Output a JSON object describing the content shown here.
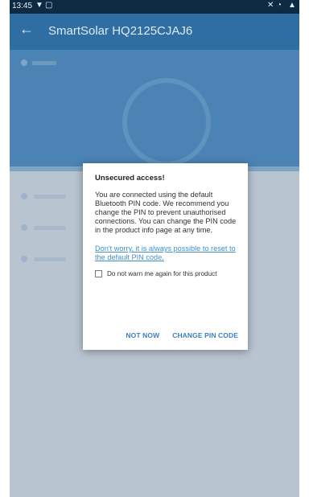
{
  "status_bar": {
    "time": "13:45",
    "icons": [
      "wifi-alert-icon",
      "image-icon",
      "mute-icon",
      "wifi-icon",
      "signal-icon"
    ]
  },
  "app_bar": {
    "back_icon": "arrow-left-icon",
    "title": "SmartSolar HQ2125CJAJ6"
  },
  "dialog": {
    "title": "Unsecured access!",
    "body": "You are connected using the default Bluetooth PIN code. We recommend you change the PIN to prevent unauthorised connections. You can change the PIN code in the product info page at any time.",
    "link": "Don't worry, it is always possible to reset to the default PIN code.",
    "checkbox_label": "Do not warn me again for this product",
    "checkbox_checked": false,
    "button_not_now": "NOT NOW",
    "button_change_pin": "CHANGE PIN CODE"
  },
  "colors": {
    "accent": "#3f7fbf",
    "link": "#3f8fd0",
    "app_bar": "#2f6ea3"
  }
}
